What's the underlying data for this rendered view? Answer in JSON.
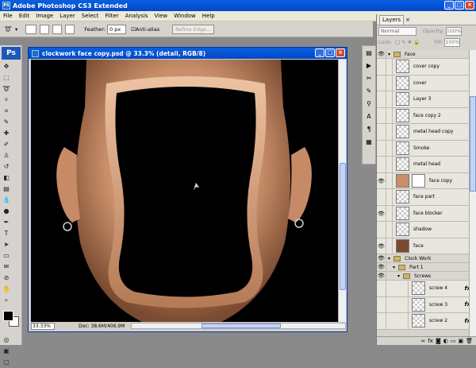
{
  "app": {
    "title": "Adobe Photoshop CS3 Extended",
    "icon": "PS"
  },
  "menu": [
    "File",
    "Edit",
    "Image",
    "Layer",
    "Select",
    "Filter",
    "Analysis",
    "View",
    "Window",
    "Help"
  ],
  "options": {
    "feather_label": "Feather:",
    "feather_value": "0 px",
    "antialias_label": "Anti-alias",
    "refine_edge": "Refine Edge..."
  },
  "toolbar": {
    "logo": "Ps"
  },
  "document": {
    "title": "clockwork face copy.psd @ 33.3% (detail, RGB/8)",
    "zoom": "33.33%",
    "doc_info": "Doc: 38.6M/406.9M"
  },
  "layers_panel": {
    "tab": "Layers",
    "close": "×",
    "blend_mode": "Normal",
    "opacity_label": "Opacity:",
    "opacity_value": "100%",
    "lock_label": "Lock:",
    "fill_label": "Fill:",
    "fill_value": "100%",
    "layers": [
      {
        "name": "Face",
        "type": "group"
      },
      {
        "name": "cover copy",
        "type": "layer"
      },
      {
        "name": "cover",
        "type": "layer"
      },
      {
        "name": "Layer 3",
        "type": "layer"
      },
      {
        "name": "face copy 2",
        "type": "layer"
      },
      {
        "name": "metal head copy",
        "type": "layer"
      },
      {
        "name": "Smoke",
        "type": "layer"
      },
      {
        "name": "metal head",
        "type": "layer"
      },
      {
        "name": "face copy",
        "type": "layer"
      },
      {
        "name": "face part",
        "type": "layer"
      },
      {
        "name": "face blocker",
        "type": "layer"
      },
      {
        "name": "shadow",
        "type": "layer"
      },
      {
        "name": "face",
        "type": "layer"
      },
      {
        "name": "Clock Work",
        "type": "group"
      },
      {
        "name": "Part 1",
        "type": "group"
      },
      {
        "name": "Screws",
        "type": "group"
      },
      {
        "name": "screw 4",
        "type": "fx"
      },
      {
        "name": "screw 3",
        "type": "fx"
      },
      {
        "name": "screw 2",
        "type": "fx"
      }
    ],
    "fx_label": "fx"
  }
}
